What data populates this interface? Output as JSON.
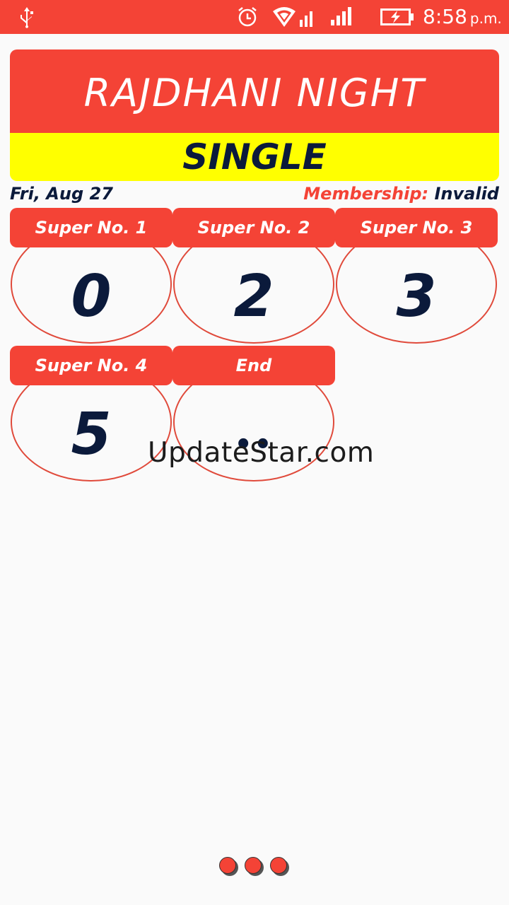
{
  "status_bar": {
    "time": "8:58",
    "ampm": "p.m.",
    "icons": [
      "usb-icon",
      "alarm-icon",
      "wifi-icon",
      "signal-icon",
      "signal-icon",
      "battery-charging-icon"
    ]
  },
  "banner": {
    "title": "RAJDHANI NIGHT",
    "subtitle": "SINGLE"
  },
  "info": {
    "date": "Fri, Aug 27",
    "membership_label": "Membership:",
    "membership_value": "Invalid"
  },
  "cards": [
    {
      "label": "Super No. 1",
      "value": "0"
    },
    {
      "label": "Super No. 2",
      "value": "2"
    },
    {
      "label": "Super No. 3",
      "value": "3"
    },
    {
      "label": "Super No. 4",
      "value": "5"
    },
    {
      "label": "End",
      "value": "••"
    }
  ],
  "watermark": "UpdateStar.com",
  "colors": {
    "primary": "#f44336",
    "accent": "#ffff00",
    "text_dark": "#0b1a3b"
  }
}
